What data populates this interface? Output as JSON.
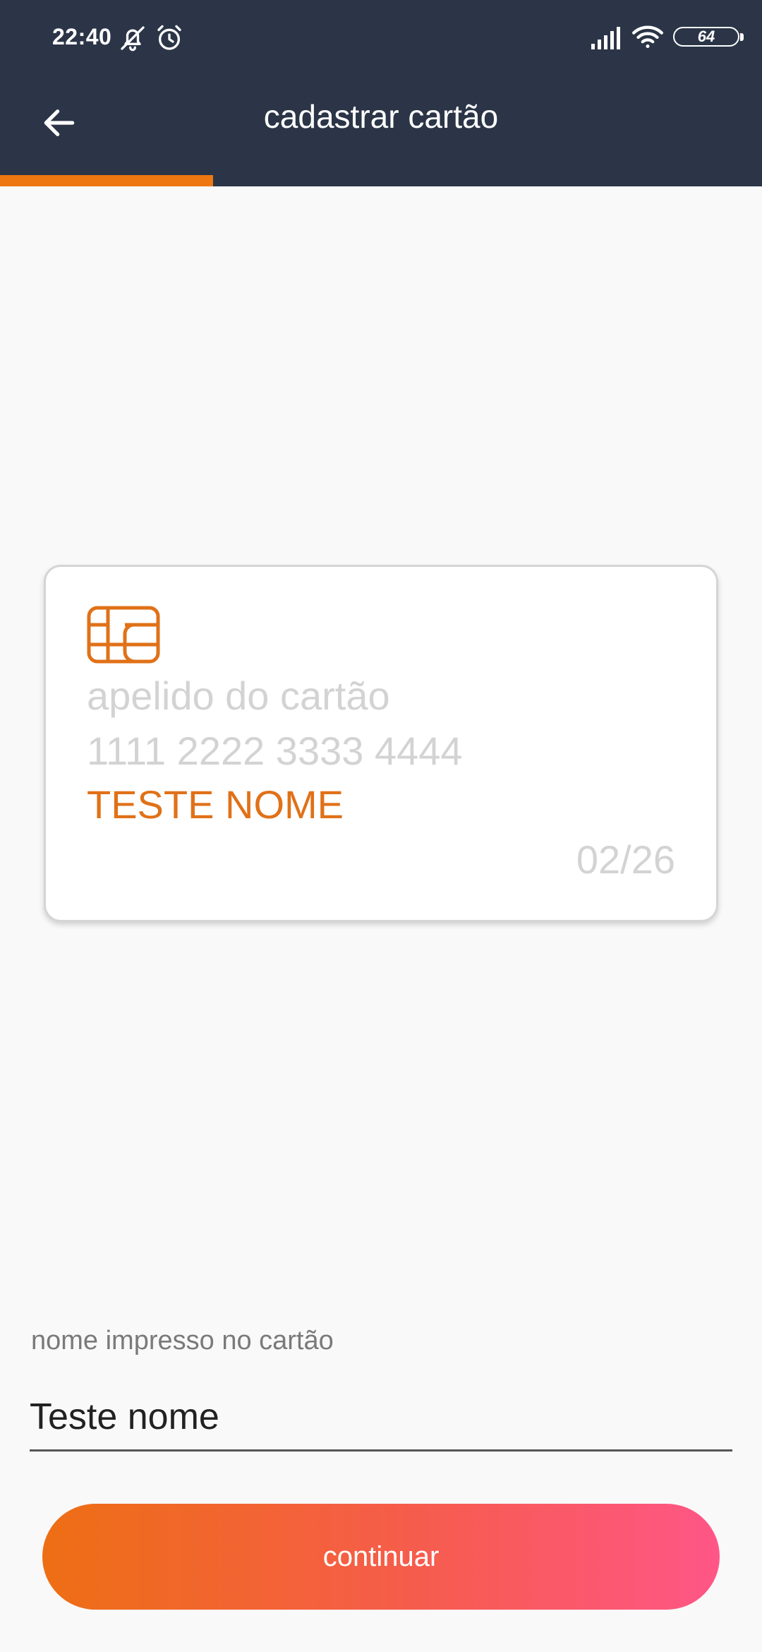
{
  "status_bar": {
    "time": "22:40",
    "battery": "64",
    "icons": [
      "bell-off-icon",
      "alarm-icon",
      "signal-icon",
      "wifi-icon",
      "battery-icon"
    ]
  },
  "header": {
    "title": "cadastrar cartão",
    "back_icon": "arrow-left-icon",
    "progress": 0.28
  },
  "card": {
    "chip_icon": "card-chip-icon",
    "nickname_placeholder": "apelido do cartão",
    "number_placeholder": "1111 2222 3333 4444",
    "holder_name": "TESTE NOME",
    "expiry": "02/26"
  },
  "form": {
    "label": "nome impresso no cartão",
    "value": "Teste nome"
  },
  "actions": {
    "continue_label": "continuar"
  },
  "colors": {
    "header_bg": "#2b3547",
    "accent": "#ee7712",
    "card_holder_text": "#e07118",
    "placeholder_text": "#d3d3d3",
    "button_gradient_start": "#ee6e14",
    "button_gradient_end": "#ff5687"
  }
}
